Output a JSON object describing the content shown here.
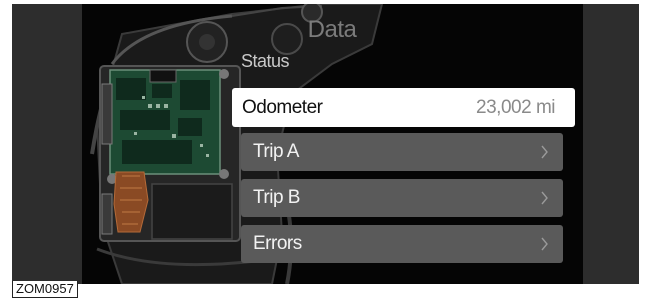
{
  "screen": {
    "title": "Data",
    "subtitle": "Status"
  },
  "menu": {
    "selected": {
      "label": "Odometer",
      "value": "23,002 mi"
    },
    "items": [
      {
        "label": "Trip A",
        "icon": "chevron-right-icon"
      },
      {
        "label": "Trip B",
        "icon": "chevron-right-icon"
      },
      {
        "label": "Errors",
        "icon": "chevron-right-icon"
      }
    ]
  },
  "caption": "ZOM0957",
  "colors": {
    "display_bg": "#050505",
    "selected_row_bg": "#ffffff",
    "row_bg": "#5a5a5a",
    "title_text": "#7b7b7b"
  }
}
